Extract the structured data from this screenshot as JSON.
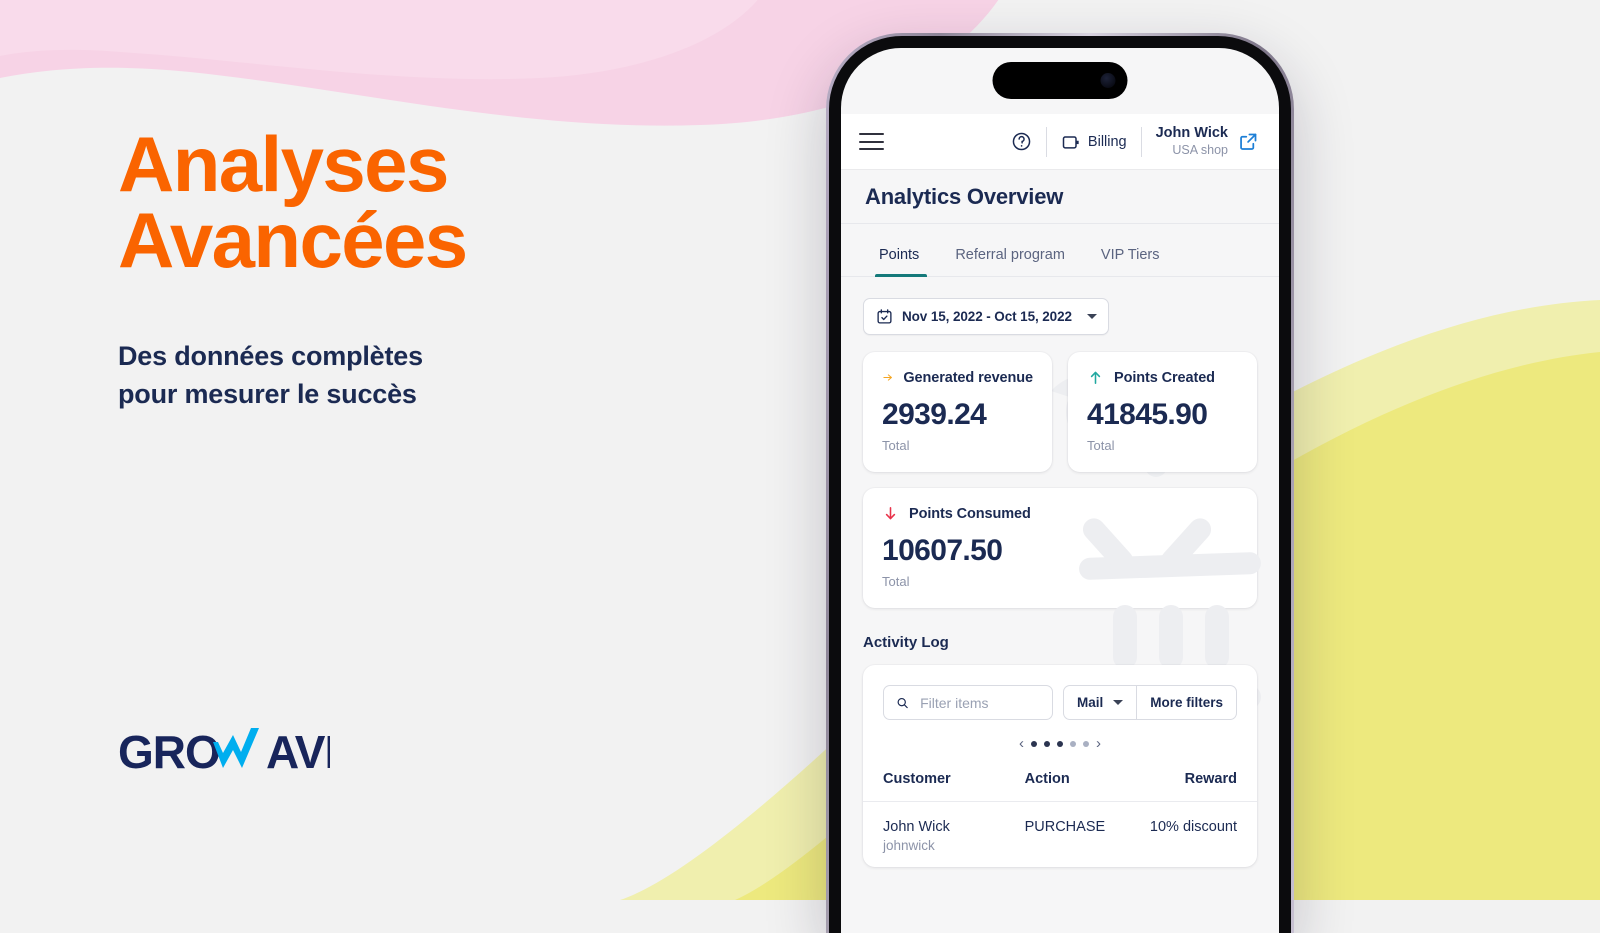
{
  "brand": {
    "logo_text_1": "GRO",
    "logo_text_2": "AVE",
    "orange": "#FA6400",
    "navy": "#1B2A52",
    "cyan": "#00AEEF",
    "teal": "#14797A"
  },
  "marketing": {
    "headline": "Analyses\nAvancées",
    "subhead": "Des données complètes\npour mesurer le succès"
  },
  "app": {
    "topbar": {
      "menu_icon": "hamburger-menu-icon",
      "help_icon": "help-circle-icon",
      "billing_icon": "billing-wallet-icon",
      "billing_label": "Billing",
      "user_name": "John Wick",
      "user_shop": "USA shop",
      "external_link_icon": "external-link-icon"
    },
    "page_title": "Analytics Overview",
    "tabs": [
      {
        "label": "Points",
        "active": true
      },
      {
        "label": "Referral program",
        "active": false
      },
      {
        "label": "VIP Tiers",
        "active": false
      }
    ],
    "date_picker": {
      "icon": "calendar-icon",
      "value": "Nov 15, 2022 - Oct 15, 2022",
      "caret_icon": "chevron-down-icon"
    },
    "stats": [
      {
        "icon": "arrow-right-icon",
        "icon_color": "#F5A623",
        "title": "Generated revenue",
        "value": "2939.24",
        "sub": "Total"
      },
      {
        "icon": "arrow-up-icon",
        "icon_color": "#21A8A0",
        "title": "Points Created",
        "value": "41845.90",
        "sub": "Total"
      },
      {
        "icon": "arrow-down-icon",
        "icon_color": "#E8334A",
        "title": "Points Consumed",
        "value": "10607.50",
        "sub": "Total"
      }
    ],
    "activity": {
      "section_title": "Activity Log",
      "search_icon": "search-icon",
      "search_placeholder": "Filter items",
      "search_value": "",
      "filter_dropdown_label": "Mail",
      "more_filters_label": "More filters",
      "pagination": {
        "prev_icon": "chevron-left-icon",
        "next_icon": "chevron-right-icon",
        "dots": 5,
        "active_dots": 3
      },
      "columns": [
        "Customer",
        "Action",
        "Reward"
      ],
      "rows": [
        {
          "customer_name": "John Wick",
          "customer_handle": "johnwick",
          "action": "PURCHASE",
          "reward": "10% discount"
        }
      ]
    }
  }
}
